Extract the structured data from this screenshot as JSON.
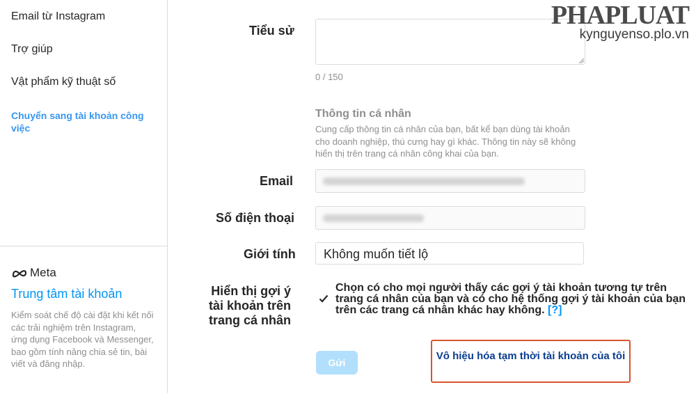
{
  "sidebar": {
    "items": [
      {
        "label": "Email từ Instagram"
      },
      {
        "label": "Trợ giúp"
      },
      {
        "label": "Vật phẩm kỹ thuật số"
      }
    ],
    "switch_account": "Chuyển sang tài khoản công việc",
    "meta": {
      "logo_text": "Meta",
      "title": "Trung tâm tài khoản",
      "description": "Kiểm soát chế độ cài đặt khi kết nối các trải nghiệm trên Instagram, ứng dụng Facebook và Messenger, bao gồm tính năng chia sẻ tin, bài viết và đăng nhập."
    }
  },
  "form": {
    "bio": {
      "label": "Tiểu sử",
      "value": "",
      "counter": "0 / 150"
    },
    "personal_info": {
      "title": "Thông tin cá nhân",
      "description": "Cung cấp thông tin cá nhân của bạn, bất kể bạn dùng tài khoản cho doanh nghiệp, thú cưng hay gì khác. Thông tin này sẽ không hiển thị trên trang cá nhân công khai của bạn."
    },
    "email": {
      "label": "Email"
    },
    "phone": {
      "label": "Số điện thoại"
    },
    "gender": {
      "label": "Giới tính",
      "value": "Không muốn tiết lộ"
    },
    "suggestions": {
      "label": "Hiển thị gợi ý tài khoản trên trang cá nhân",
      "checked": true,
      "text": "Chọn có cho mọi người thấy các gợi ý tài khoản tương tự trên trang cá nhân của bạn và có cho hệ thống gợi ý tài khoản của bạn trên các trang cá nhân khác hay không.",
      "help": "[?]"
    },
    "submit_label": "Gửi",
    "disable_label": "Vô hiệu hóa tạm thời tài khoản của tôi"
  },
  "watermark": {
    "brand": "PHAPLUAT",
    "site": "kynguyenso.plo.vn"
  },
  "colors": {
    "accent": "#0095f6",
    "link": "#3897f0",
    "highlight_border": "#d9542b",
    "disabled_button": "#b2dffc"
  }
}
